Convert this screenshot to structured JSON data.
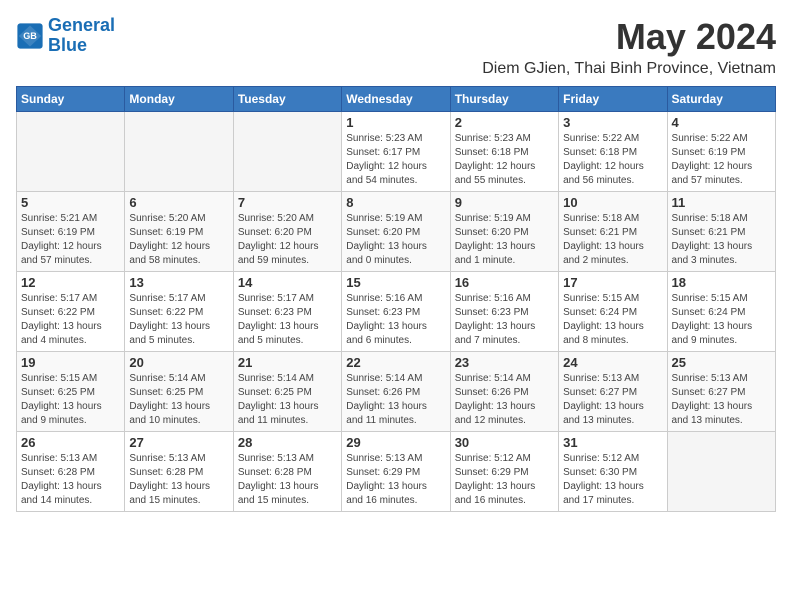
{
  "logo": {
    "line1": "General",
    "line2": "Blue"
  },
  "title": "May 2024",
  "subtitle": "Diem GJien, Thai Binh Province, Vietnam",
  "weekdays": [
    "Sunday",
    "Monday",
    "Tuesday",
    "Wednesday",
    "Thursday",
    "Friday",
    "Saturday"
  ],
  "weeks": [
    [
      {
        "day": "",
        "info": ""
      },
      {
        "day": "",
        "info": ""
      },
      {
        "day": "",
        "info": ""
      },
      {
        "day": "1",
        "info": "Sunrise: 5:23 AM\nSunset: 6:17 PM\nDaylight: 12 hours\nand 54 minutes."
      },
      {
        "day": "2",
        "info": "Sunrise: 5:23 AM\nSunset: 6:18 PM\nDaylight: 12 hours\nand 55 minutes."
      },
      {
        "day": "3",
        "info": "Sunrise: 5:22 AM\nSunset: 6:18 PM\nDaylight: 12 hours\nand 56 minutes."
      },
      {
        "day": "4",
        "info": "Sunrise: 5:22 AM\nSunset: 6:19 PM\nDaylight: 12 hours\nand 57 minutes."
      }
    ],
    [
      {
        "day": "5",
        "info": "Sunrise: 5:21 AM\nSunset: 6:19 PM\nDaylight: 12 hours\nand 57 minutes."
      },
      {
        "day": "6",
        "info": "Sunrise: 5:20 AM\nSunset: 6:19 PM\nDaylight: 12 hours\nand 58 minutes."
      },
      {
        "day": "7",
        "info": "Sunrise: 5:20 AM\nSunset: 6:20 PM\nDaylight: 12 hours\nand 59 minutes."
      },
      {
        "day": "8",
        "info": "Sunrise: 5:19 AM\nSunset: 6:20 PM\nDaylight: 13 hours\nand 0 minutes."
      },
      {
        "day": "9",
        "info": "Sunrise: 5:19 AM\nSunset: 6:20 PM\nDaylight: 13 hours\nand 1 minute."
      },
      {
        "day": "10",
        "info": "Sunrise: 5:18 AM\nSunset: 6:21 PM\nDaylight: 13 hours\nand 2 minutes."
      },
      {
        "day": "11",
        "info": "Sunrise: 5:18 AM\nSunset: 6:21 PM\nDaylight: 13 hours\nand 3 minutes."
      }
    ],
    [
      {
        "day": "12",
        "info": "Sunrise: 5:17 AM\nSunset: 6:22 PM\nDaylight: 13 hours\nand 4 minutes."
      },
      {
        "day": "13",
        "info": "Sunrise: 5:17 AM\nSunset: 6:22 PM\nDaylight: 13 hours\nand 5 minutes."
      },
      {
        "day": "14",
        "info": "Sunrise: 5:17 AM\nSunset: 6:23 PM\nDaylight: 13 hours\nand 5 minutes."
      },
      {
        "day": "15",
        "info": "Sunrise: 5:16 AM\nSunset: 6:23 PM\nDaylight: 13 hours\nand 6 minutes."
      },
      {
        "day": "16",
        "info": "Sunrise: 5:16 AM\nSunset: 6:23 PM\nDaylight: 13 hours\nand 7 minutes."
      },
      {
        "day": "17",
        "info": "Sunrise: 5:15 AM\nSunset: 6:24 PM\nDaylight: 13 hours\nand 8 minutes."
      },
      {
        "day": "18",
        "info": "Sunrise: 5:15 AM\nSunset: 6:24 PM\nDaylight: 13 hours\nand 9 minutes."
      }
    ],
    [
      {
        "day": "19",
        "info": "Sunrise: 5:15 AM\nSunset: 6:25 PM\nDaylight: 13 hours\nand 9 minutes."
      },
      {
        "day": "20",
        "info": "Sunrise: 5:14 AM\nSunset: 6:25 PM\nDaylight: 13 hours\nand 10 minutes."
      },
      {
        "day": "21",
        "info": "Sunrise: 5:14 AM\nSunset: 6:25 PM\nDaylight: 13 hours\nand 11 minutes."
      },
      {
        "day": "22",
        "info": "Sunrise: 5:14 AM\nSunset: 6:26 PM\nDaylight: 13 hours\nand 11 minutes."
      },
      {
        "day": "23",
        "info": "Sunrise: 5:14 AM\nSunset: 6:26 PM\nDaylight: 13 hours\nand 12 minutes."
      },
      {
        "day": "24",
        "info": "Sunrise: 5:13 AM\nSunset: 6:27 PM\nDaylight: 13 hours\nand 13 minutes."
      },
      {
        "day": "25",
        "info": "Sunrise: 5:13 AM\nSunset: 6:27 PM\nDaylight: 13 hours\nand 13 minutes."
      }
    ],
    [
      {
        "day": "26",
        "info": "Sunrise: 5:13 AM\nSunset: 6:28 PM\nDaylight: 13 hours\nand 14 minutes."
      },
      {
        "day": "27",
        "info": "Sunrise: 5:13 AM\nSunset: 6:28 PM\nDaylight: 13 hours\nand 15 minutes."
      },
      {
        "day": "28",
        "info": "Sunrise: 5:13 AM\nSunset: 6:28 PM\nDaylight: 13 hours\nand 15 minutes."
      },
      {
        "day": "29",
        "info": "Sunrise: 5:13 AM\nSunset: 6:29 PM\nDaylight: 13 hours\nand 16 minutes."
      },
      {
        "day": "30",
        "info": "Sunrise: 5:12 AM\nSunset: 6:29 PM\nDaylight: 13 hours\nand 16 minutes."
      },
      {
        "day": "31",
        "info": "Sunrise: 5:12 AM\nSunset: 6:30 PM\nDaylight: 13 hours\nand 17 minutes."
      },
      {
        "day": "",
        "info": ""
      }
    ]
  ]
}
